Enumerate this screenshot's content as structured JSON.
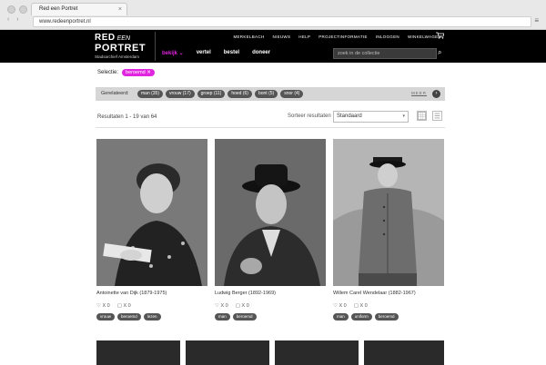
{
  "browser": {
    "tab_title": "Red een Portret",
    "url": "www.redeenportret.nl",
    "close": "×",
    "nav_arrows": "‹ ›",
    "menu": "≡"
  },
  "header": {
    "logo_red": "RED",
    "logo_een": "EEN",
    "logo_portret": "PORTRET",
    "logo_sub": "Stadsarchief Amsterdam",
    "topnav": [
      "MERKELBACH",
      "NIEUWS",
      "HELP",
      "PROJECTINFORMATIE",
      "INLOGGEN",
      "WINKELWAGEN"
    ],
    "cart_icon": "cart-icon",
    "mainnav": [
      "bekijk",
      "vertel",
      "bestel",
      "doneer"
    ],
    "mainnav_active_suffix": " ⌄",
    "search_placeholder": "zoek in de collectie",
    "search_icon": "⌕"
  },
  "selection": {
    "label": "Selectie:",
    "chip": "beroemd ✕"
  },
  "related": {
    "label": "Gerelateerd:",
    "chips": [
      "man (35)",
      "vrouw (17)",
      "groep (11)",
      "hoed (6)",
      "bont (5)",
      "snor (4)"
    ],
    "more": "MEER",
    "more_icon": "›"
  },
  "results": {
    "count_text": "Resultaten 1 - 19 van 64",
    "sort_label": "Sorteer resultaten",
    "sort_value": "Standaard",
    "sort_caret": "▾"
  },
  "cards": [
    {
      "caption": "Antoinette van Dijk (1879-1975)",
      "likes": "♡ X 0",
      "comments": "▢ X 0",
      "tags": [
        "vrouw",
        "beroemd",
        "lezen"
      ]
    },
    {
      "caption": "Ludwig Berger (1892-1969)",
      "likes": "♡ X 0",
      "comments": "▢ X 0",
      "tags": [
        "man",
        "beroemd"
      ]
    },
    {
      "caption": "Willem Carel Wendelaar (1882-1967)",
      "likes": "♡ X 0",
      "comments": "▢ X 0",
      "tags": [
        "man",
        "uniform",
        "beroemd"
      ]
    }
  ],
  "colors": {
    "accent": "#e024e0",
    "header_bg": "#000000"
  }
}
